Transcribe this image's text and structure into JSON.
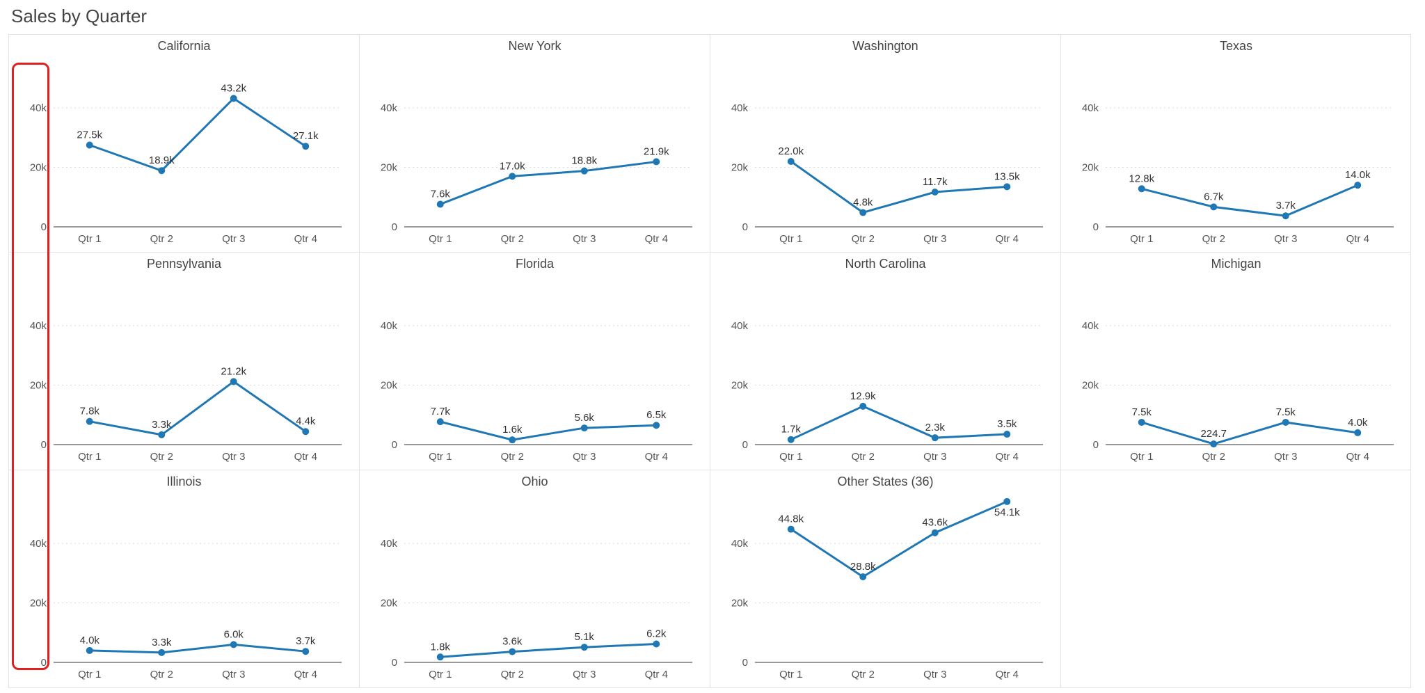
{
  "title": "Sales by Quarter",
  "chart_data": [
    {
      "type": "line",
      "panel": "California",
      "categories": [
        "Qtr 1",
        "Qtr 2",
        "Qtr 3",
        "Qtr 4"
      ],
      "values": [
        27500,
        18900,
        43200,
        27100
      ],
      "value_labels": [
        "27.5k",
        "18.9k",
        "43.2k",
        "27.1k"
      ],
      "yticks": [
        0,
        20000,
        40000
      ],
      "ytick_labels": [
        "0",
        "20k",
        "40k"
      ],
      "ylim": [
        0,
        55000
      ]
    },
    {
      "type": "line",
      "panel": "New York",
      "categories": [
        "Qtr 1",
        "Qtr 2",
        "Qtr 3",
        "Qtr 4"
      ],
      "values": [
        7600,
        17000,
        18800,
        21900
      ],
      "value_labels": [
        "7.6k",
        "17.0k",
        "18.8k",
        "21.9k"
      ],
      "yticks": [
        0,
        20000,
        40000
      ],
      "ytick_labels": [
        "0",
        "20k",
        "40k"
      ],
      "ylim": [
        0,
        55000
      ]
    },
    {
      "type": "line",
      "panel": "Washington",
      "categories": [
        "Qtr 1",
        "Qtr 2",
        "Qtr 3",
        "Qtr 4"
      ],
      "values": [
        22000,
        4800,
        11700,
        13500
      ],
      "value_labels": [
        "22.0k",
        "4.8k",
        "11.7k",
        "13.5k"
      ],
      "yticks": [
        0,
        20000,
        40000
      ],
      "ytick_labels": [
        "0",
        "20k",
        "40k"
      ],
      "ylim": [
        0,
        55000
      ]
    },
    {
      "type": "line",
      "panel": "Texas",
      "categories": [
        "Qtr 1",
        "Qtr 2",
        "Qtr 3",
        "Qtr 4"
      ],
      "values": [
        12800,
        6700,
        3700,
        14000
      ],
      "value_labels": [
        "12.8k",
        "6.7k",
        "3.7k",
        "14.0k"
      ],
      "yticks": [
        0,
        20000,
        40000
      ],
      "ytick_labels": [
        "0",
        "20k",
        "40k"
      ],
      "ylim": [
        0,
        55000
      ]
    },
    {
      "type": "line",
      "panel": "Pennsylvania",
      "categories": [
        "Qtr 1",
        "Qtr 2",
        "Qtr 3",
        "Qtr 4"
      ],
      "values": [
        7800,
        3300,
        21200,
        4400
      ],
      "value_labels": [
        "7.8k",
        "3.3k",
        "21.2k",
        "4.4k"
      ],
      "yticks": [
        0,
        20000,
        40000
      ],
      "ytick_labels": [
        "0",
        "20k",
        "40k"
      ],
      "ylim": [
        0,
        55000
      ]
    },
    {
      "type": "line",
      "panel": "Florida",
      "categories": [
        "Qtr 1",
        "Qtr 2",
        "Qtr 3",
        "Qtr 4"
      ],
      "values": [
        7700,
        1600,
        5600,
        6500
      ],
      "value_labels": [
        "7.7k",
        "1.6k",
        "5.6k",
        "6.5k"
      ],
      "yticks": [
        0,
        20000,
        40000
      ],
      "ytick_labels": [
        "0",
        "20k",
        "40k"
      ],
      "ylim": [
        0,
        55000
      ]
    },
    {
      "type": "line",
      "panel": "North Carolina",
      "categories": [
        "Qtr 1",
        "Qtr 2",
        "Qtr 3",
        "Qtr 4"
      ],
      "values": [
        1700,
        12900,
        2300,
        3500
      ],
      "value_labels": [
        "1.7k",
        "12.9k",
        "2.3k",
        "3.5k"
      ],
      "yticks": [
        0,
        20000,
        40000
      ],
      "ytick_labels": [
        "0",
        "20k",
        "40k"
      ],
      "ylim": [
        0,
        55000
      ]
    },
    {
      "type": "line",
      "panel": "Michigan",
      "categories": [
        "Qtr 1",
        "Qtr 2",
        "Qtr 3",
        "Qtr 4"
      ],
      "values": [
        7500,
        224.7,
        7500,
        4000
      ],
      "value_labels": [
        "7.5k",
        "224.7",
        "7.5k",
        "4.0k"
      ],
      "yticks": [
        0,
        20000,
        40000
      ],
      "ytick_labels": [
        "0",
        "20k",
        "40k"
      ],
      "ylim": [
        0,
        55000
      ]
    },
    {
      "type": "line",
      "panel": "Illinois",
      "categories": [
        "Qtr 1",
        "Qtr 2",
        "Qtr 3",
        "Qtr 4"
      ],
      "values": [
        4000,
        3300,
        6000,
        3700
      ],
      "value_labels": [
        "4.0k",
        "3.3k",
        "6.0k",
        "3.7k"
      ],
      "yticks": [
        0,
        20000,
        40000
      ],
      "ytick_labels": [
        "0",
        "20k",
        "40k"
      ],
      "ylim": [
        0,
        55000
      ]
    },
    {
      "type": "line",
      "panel": "Ohio",
      "categories": [
        "Qtr 1",
        "Qtr 2",
        "Qtr 3",
        "Qtr 4"
      ],
      "values": [
        1800,
        3600,
        5100,
        6200
      ],
      "value_labels": [
        "1.8k",
        "3.6k",
        "5.1k",
        "6.2k"
      ],
      "yticks": [
        0,
        20000,
        40000
      ],
      "ytick_labels": [
        "0",
        "20k",
        "40k"
      ],
      "ylim": [
        0,
        55000
      ]
    },
    {
      "type": "line",
      "panel": "Other States (36)",
      "categories": [
        "Qtr 1",
        "Qtr 2",
        "Qtr 3",
        "Qtr 4"
      ],
      "values": [
        44800,
        28800,
        43600,
        54100
      ],
      "value_labels": [
        "44.8k",
        "28.8k",
        "43.6k",
        "54.1k"
      ],
      "yticks": [
        0,
        20000,
        40000
      ],
      "ytick_labels": [
        "0",
        "20k",
        "40k"
      ],
      "ylim": [
        0,
        55000
      ]
    }
  ],
  "annotation": {
    "type": "box",
    "description": "y-axis-column-highlight",
    "color": "#e02020"
  }
}
